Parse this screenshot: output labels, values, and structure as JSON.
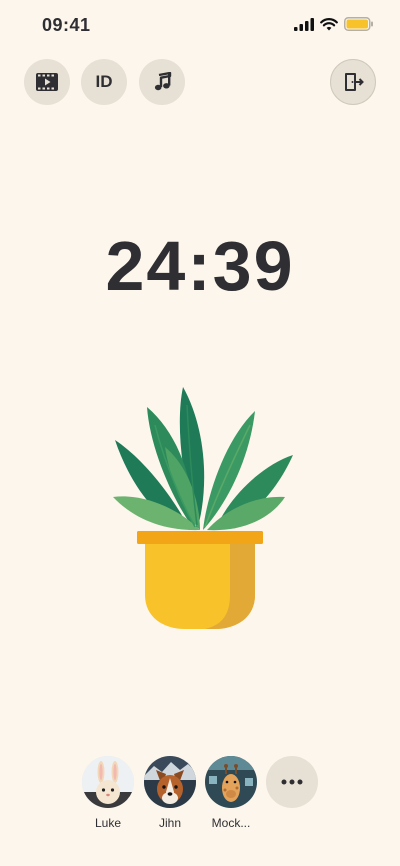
{
  "status_bar": {
    "time": "09:41",
    "icons": [
      "signal-icon",
      "wifi-icon",
      "battery-icon"
    ],
    "battery_color": "#f7c22a"
  },
  "toolbar": {
    "left_buttons": [
      {
        "icon": "film-icon"
      },
      {
        "label": "ID"
      },
      {
        "icon": "music-note-icon"
      }
    ],
    "right_button": {
      "icon": "exit-door-icon"
    }
  },
  "timer": {
    "display": "24:39"
  },
  "illustration": {
    "subject": "potted-plant",
    "leaf_colors": [
      "#1f7a57",
      "#3b9a63",
      "#6cb36f"
    ],
    "pot_color": "#f7c22a",
    "pot_rim_color": "#f2a516"
  },
  "friends": [
    {
      "name": "Luke",
      "avatar": "rabbit-avatar"
    },
    {
      "name": "Jihn",
      "avatar": "dog-avatar"
    },
    {
      "name": "Mock...",
      "avatar": "giraffe-avatar"
    }
  ],
  "more_button": {
    "icon": "more-dots-icon"
  },
  "colors": {
    "background": "#fcf6ec",
    "button_background": "#e6e0d5",
    "text": "#2f2f33"
  }
}
